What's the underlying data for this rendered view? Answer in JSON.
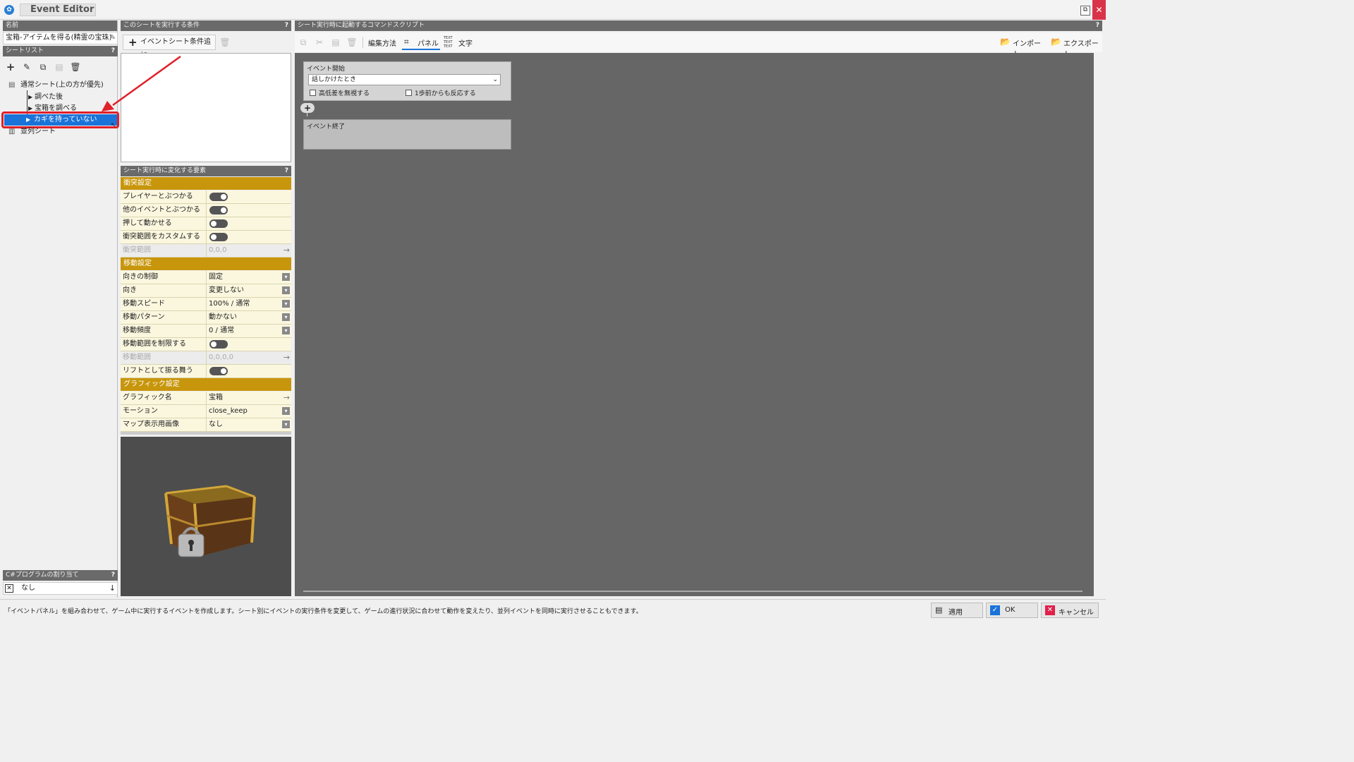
{
  "window": {
    "title": "Event Editor",
    "restore_icon": "restore-icon",
    "close_icon": "close-icon"
  },
  "left": {
    "name_header": "名前",
    "name_value": "宝箱-アイテムを得る(精霊の宝珠)",
    "sheetlist_header": "シートリスト",
    "help": "?",
    "tree": {
      "root": "通常シート(上の方が優先)",
      "children": [
        "調べた後",
        "宝箱を調べる",
        "カギを持っていない"
      ],
      "parallel": "並列シート"
    },
    "csharp_header": "C#プログラムの割り当て",
    "csharp_value": "なし"
  },
  "conditions": {
    "header": "このシートを実行する条件",
    "add_label": "イベントシート条件追加"
  },
  "properties": {
    "header": "シート実行時に変化する要素",
    "sections": {
      "collision": "衝突設定",
      "movement": "移動設定",
      "graphic": "グラフィック設定"
    },
    "rows": {
      "player_collide": "プレイヤーとぶつかる",
      "event_collide": "他のイベントとぶつかる",
      "pushable": "押して動かせる",
      "custom_range": "衝突範囲をカスタムする",
      "collision_range": "衝突範囲",
      "collision_range_val": "0,0,0",
      "dir_control": "向きの制御",
      "dir_control_val": "固定",
      "direction": "向き",
      "direction_val": "変更しない",
      "speed": "移動スピード",
      "speed_val": "100% / 通常",
      "pattern": "移動パターン",
      "pattern_val": "動かない",
      "frequency": "移動頻度",
      "frequency_val": "0 / 通常",
      "limit_range": "移動範囲を制限する",
      "move_range": "移動範囲",
      "move_range_val": "0,0,0,0",
      "lift": "リフトとして振る舞う",
      "graphic_name": "グラフィック名",
      "graphic_name_val": "宝箱",
      "motion": "モーション",
      "motion_val": "close_keep",
      "map_image": "マップ表示用画像",
      "map_image_val": "なし"
    }
  },
  "script": {
    "header": "シート実行時に起動するコマンドスクリプト",
    "edit_method": "編集方法",
    "panel": "パネル",
    "text_mode": "文字",
    "import": "インポート",
    "export": "エクスポート",
    "event_start": "イベント開始",
    "trigger": "話しかけたとき",
    "ignore_height": "高低差を無視する",
    "one_step": "1歩前からも反応する",
    "event_end": "イベント終了"
  },
  "status": {
    "text": "「イベントパネル」を組み合わせて、ゲーム中に実行するイベントを作成します。シート別にイベントの実行条件を変更して、ゲームの進行状況に合わせて動作を変えたり、並列イベントを同時に実行させることもできます。",
    "apply": "適用",
    "ok": "OK",
    "cancel": "キャンセル"
  },
  "colors": {
    "accent": "#c8960c",
    "selection": "#1a73d9",
    "callout": "#e0202a",
    "canvas": "#666666"
  }
}
